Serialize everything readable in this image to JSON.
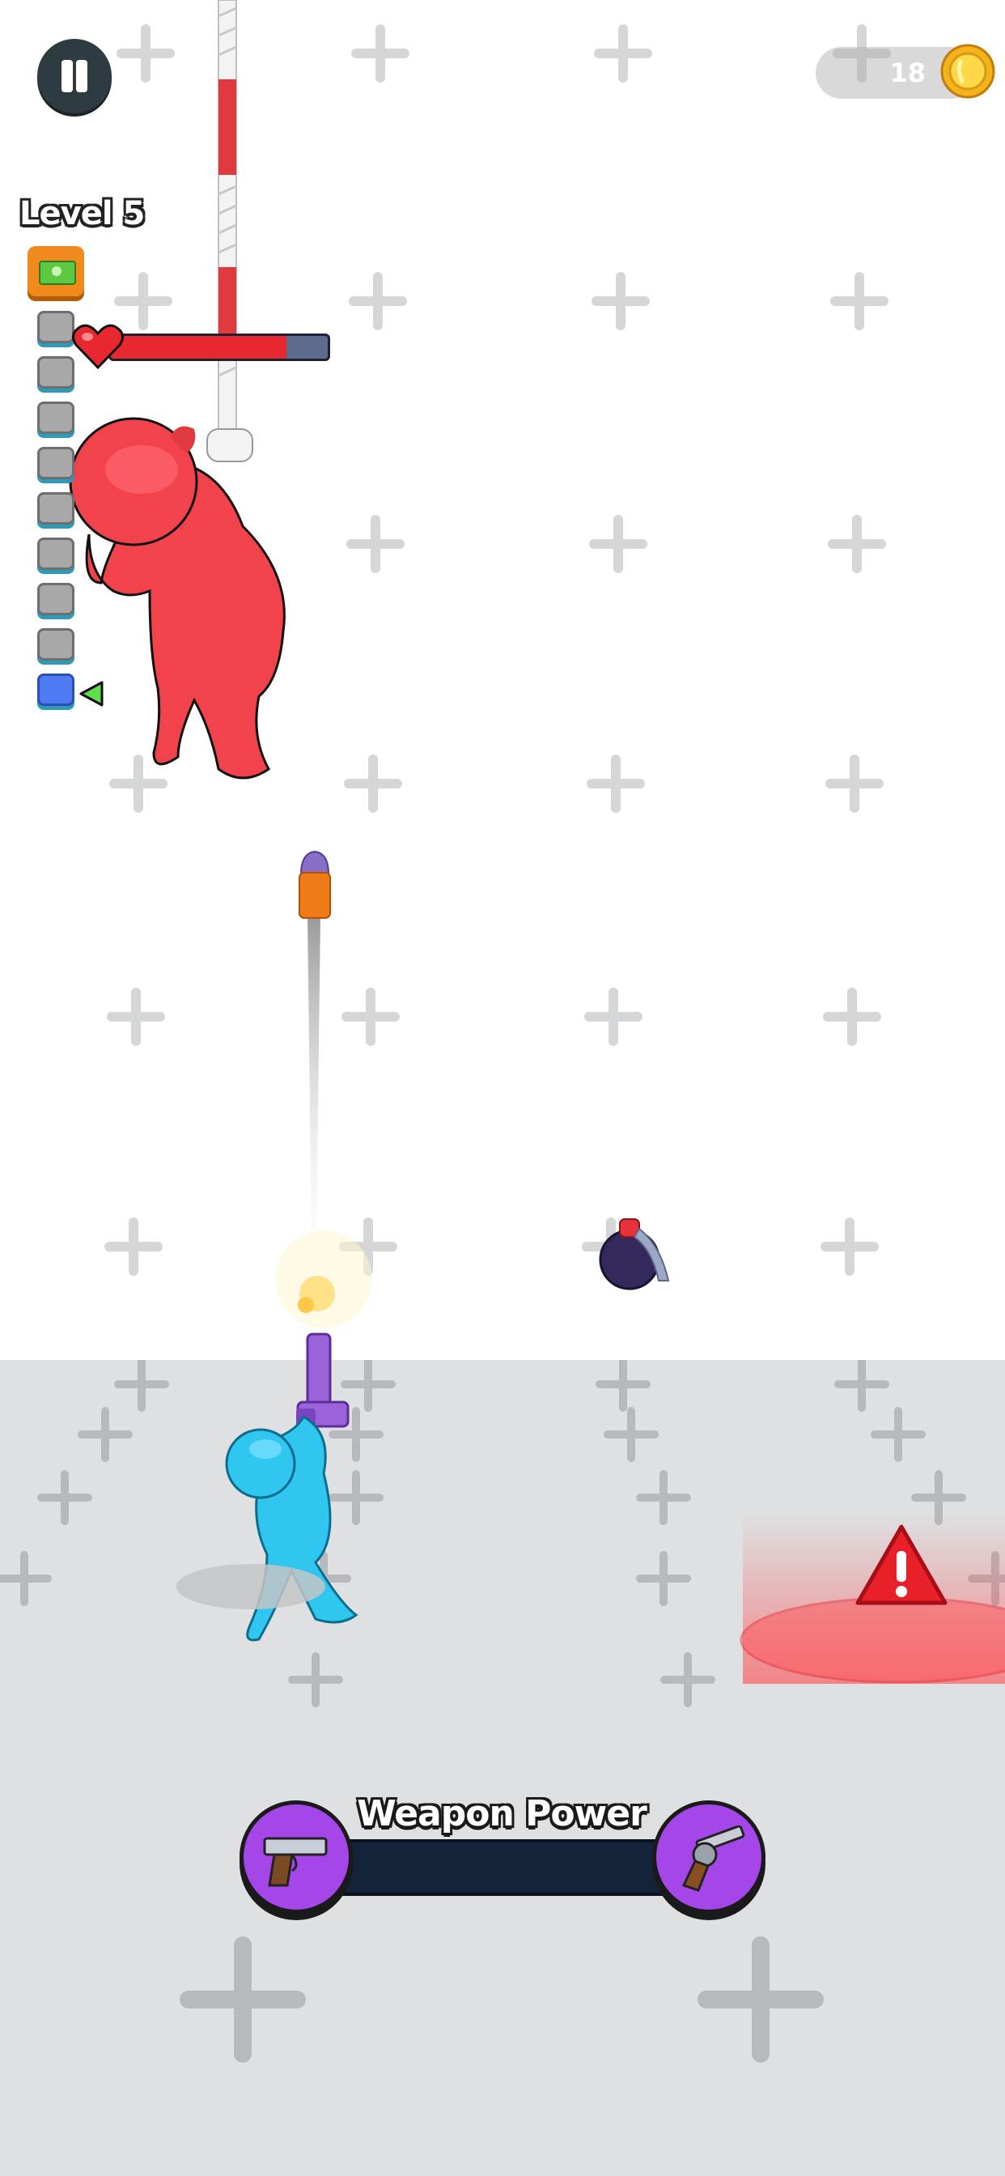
{
  "hud": {
    "pause_icon": "pause-icon",
    "coins": "18",
    "coin_icon": "gold-coin-icon",
    "level_label": "Level 5"
  },
  "progress": {
    "reward_icon": "cash-stack-icon",
    "total_steps": 9,
    "current_step": 9
  },
  "enemy": {
    "health_icon": "heart-icon",
    "health_fraction": 0.81
  },
  "weapon_power": {
    "title": "Weapon Power",
    "current_weapon_icon": "pistol-icon",
    "next_weapon_icon": "revolver-icon",
    "fill_fraction": 0.03
  },
  "hazard": {
    "warning_icon": "warning-triangle-icon"
  },
  "colors": {
    "enemy": "#f2434c",
    "player": "#2fc7f0",
    "weapon_power": "#a446e8",
    "health": "#e7292f",
    "hazard": "#e8202a"
  }
}
